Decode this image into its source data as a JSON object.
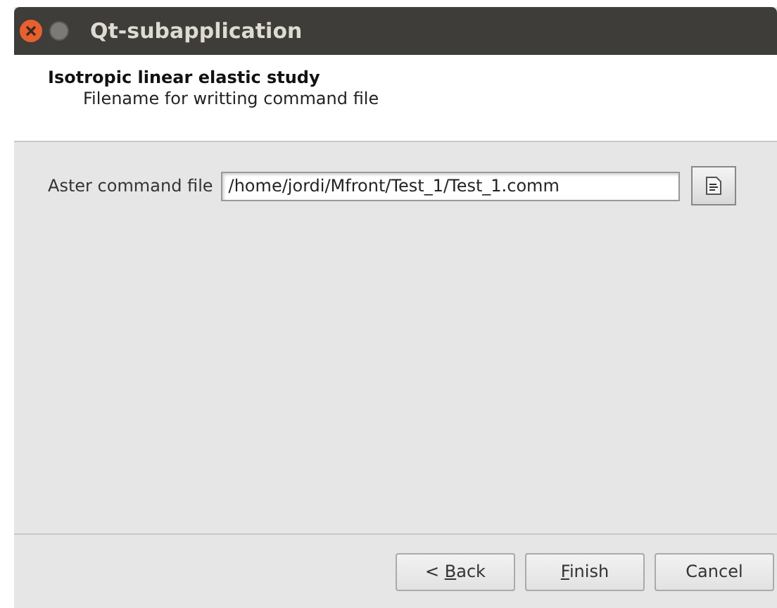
{
  "window": {
    "title": "Qt-subapplication"
  },
  "header": {
    "title": "Isotropic linear elastic study",
    "subtitle": "Filename for writting command file"
  },
  "field": {
    "label": "Aster command file",
    "value": "/home/jordi/Mfront/Test_1/Test_1.comm"
  },
  "buttons": [
    {
      "before": "< ",
      "mnemonic": "B",
      "after": "ack"
    },
    {
      "mnemonic": "F",
      "after": "inish"
    },
    {
      "before": "Cancel"
    }
  ]
}
